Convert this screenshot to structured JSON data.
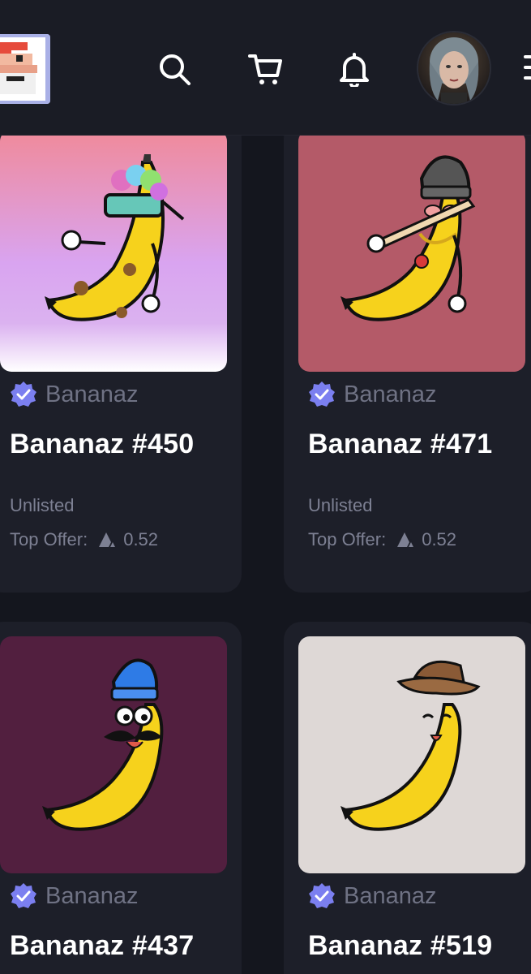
{
  "header": {
    "logo_icon": "pixel-character-logo",
    "search_icon": "search-icon",
    "cart_icon": "cart-icon",
    "bell_icon": "bell-icon",
    "avatar_icon": "user-avatar",
    "menu_icon": "menu-icon"
  },
  "colors": {
    "background": "#14161e",
    "card": "#1d1f29",
    "accent": "#7b7ff0",
    "muted_text": "#7d8093",
    "white": "#ffffff"
  },
  "cards": [
    {
      "collection": "Bananaz",
      "title": "Bananaz #450",
      "status": "Unlisted",
      "offer_label": "Top Offer:",
      "offer_value": "0.52",
      "bg": "gradient-pink-purple"
    },
    {
      "collection": "Bananaz",
      "title": "Bananaz #471",
      "status": "Unlisted",
      "offer_label": "Top Offer:",
      "offer_value": "0.52",
      "bg": "#b45a68"
    },
    {
      "collection": "Bananaz",
      "title": "Bananaz #437",
      "bg": "#521f3f"
    },
    {
      "collection": "Bananaz",
      "title": "Bananaz #519",
      "bg": "#ded8d6"
    }
  ]
}
